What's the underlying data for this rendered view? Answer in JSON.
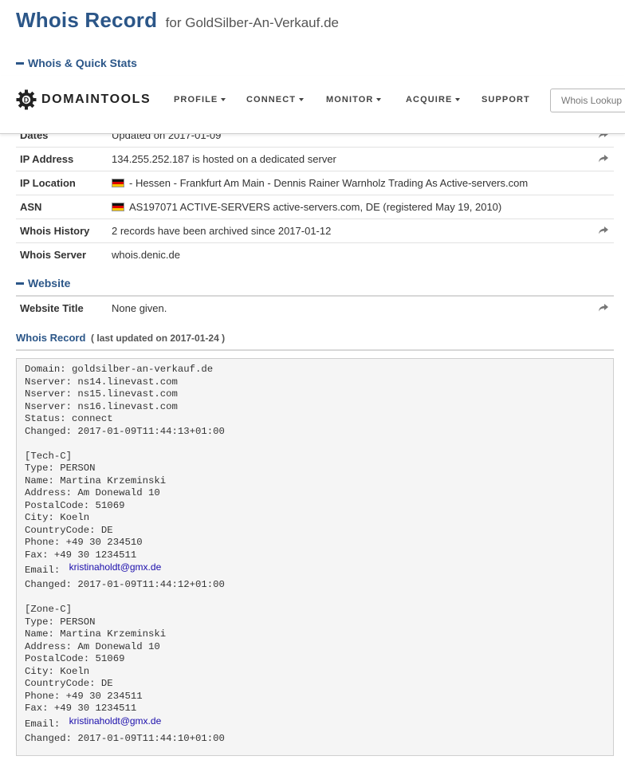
{
  "title": {
    "main": "Whois Record",
    "sub": "for GoldSilber-An-Verkauf.de"
  },
  "sections": {
    "quick_stats": "Whois & Quick Stats",
    "website": "Website"
  },
  "navbar": {
    "logo": "DOMAINTOOLS",
    "items": [
      "PROFILE",
      "CONNECT",
      "MONITOR",
      "ACQUIRE",
      "SUPPORT"
    ],
    "search_placeholder": "Whois Lookup"
  },
  "stats_rows": [
    {
      "label": "Dates",
      "value": "Updated on 2017-01-09"
    },
    {
      "label": "IP Address",
      "value": "134.255.252.187 is hosted on a dedicated server"
    },
    {
      "label": "IP Location",
      "value": "- Hessen - Frankfurt Am Main - Dennis Rainer Warnholz Trading As Active-servers.com"
    },
    {
      "label": "ASN",
      "value": "AS197071 ACTIVE-SERVERS active-servers.com, DE (registered May 19, 2010)"
    },
    {
      "label": "Whois History",
      "value": "2 records have been archived since 2017-01-12"
    },
    {
      "label": "Whois Server",
      "value": "whois.denic.de"
    }
  ],
  "website_rows": [
    {
      "label": "Website Title",
      "value": "None given."
    }
  ],
  "whois_record": {
    "title": "Whois Record",
    "updated": "( last updated on 2017-01-24 )",
    "lines": {
      "domain": "Domain: goldsilber-an-verkauf.de",
      "ns1": "Nserver: ns14.linevast.com",
      "ns2": "Nserver: ns15.linevast.com",
      "ns3": "Nserver: ns16.linevast.com",
      "status": "Status: connect",
      "changed": "Changed: 2017-01-09T11:44:13+01:00"
    },
    "tech": {
      "header": "[Tech-C]",
      "type": "Type: PERSON",
      "name": "Name: Martina Krzeminski",
      "address": "Address: Am Donewald 10",
      "postal": "PostalCode: 51069",
      "city": "City: Koeln",
      "country": "CountryCode: DE",
      "phone": "Phone: +49 30 234510",
      "fax": "Fax: +49 30 1234511",
      "email_label": "Email:",
      "email": "kristinaholdt@gmx.de",
      "changed": "Changed: 2017-01-09T11:44:12+01:00"
    },
    "zone": {
      "header": "[Zone-C]",
      "type": "Type: PERSON",
      "name": "Name: Martina Krzeminski",
      "address": "Address: Am Donewald 10",
      "postal": "PostalCode: 51069",
      "city": "City: Koeln",
      "country": "CountryCode: DE",
      "phone": "Phone: +49 30 234511",
      "fax": "Fax: +49 30 1234511",
      "email_label": "Email:",
      "email": "kristinaholdt@gmx.de",
      "changed": "Changed: 2017-01-09T11:44:10+01:00"
    }
  },
  "colors": {
    "brand": "#2b5688",
    "link": "#1a0dab"
  }
}
